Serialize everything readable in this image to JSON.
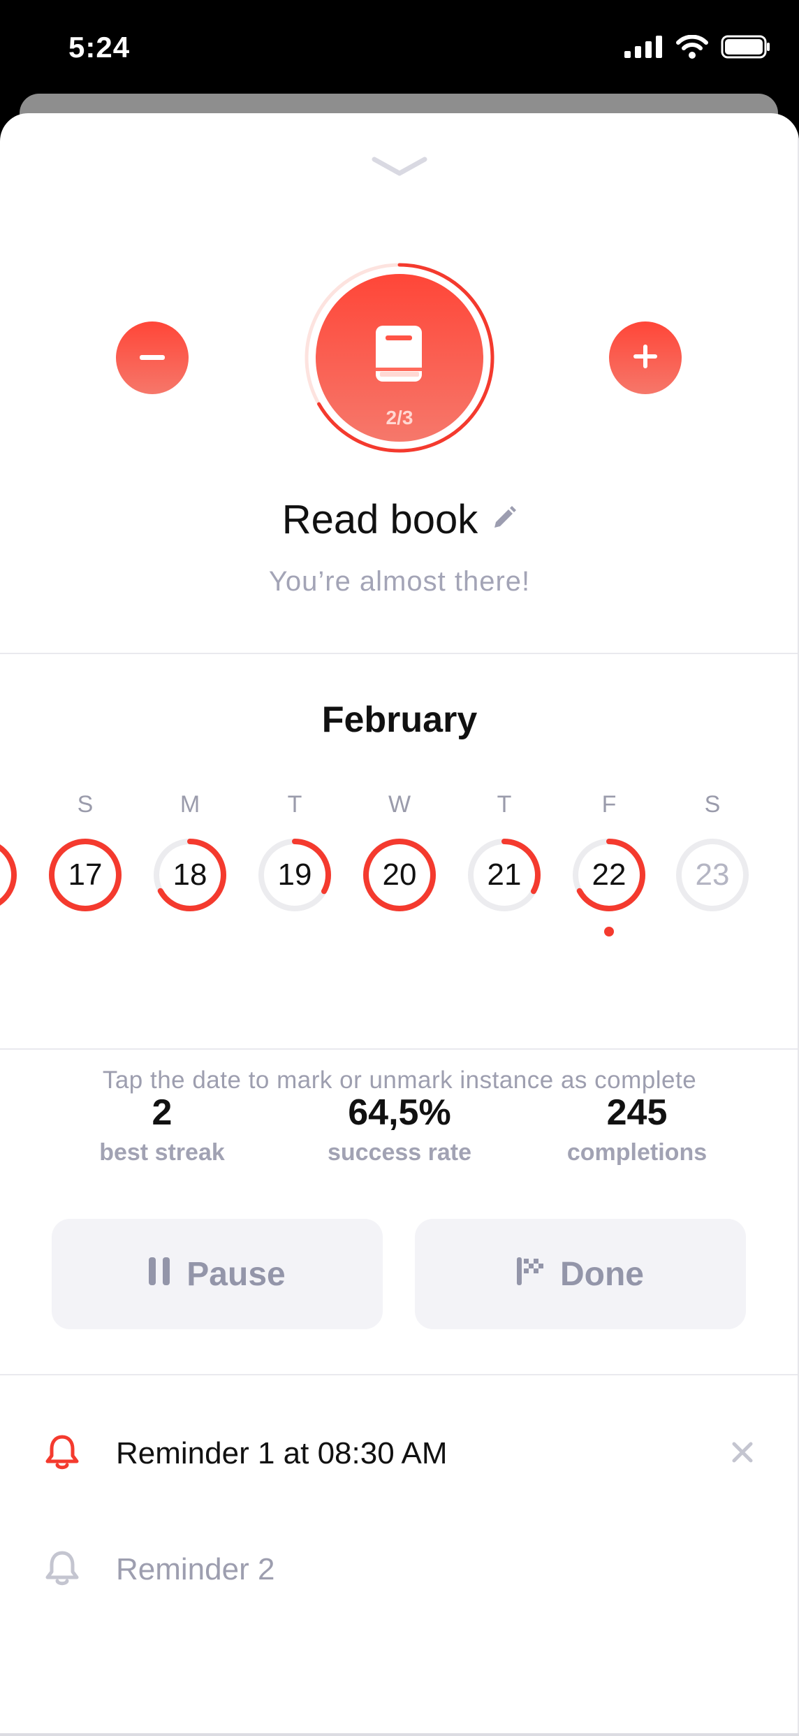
{
  "status_bar": {
    "time": "5:24",
    "icons": [
      "signal-icon",
      "wifi-icon",
      "battery-icon"
    ]
  },
  "habit": {
    "title": "Read book",
    "subtitle": "You’re almost there!",
    "progress_text": "2/3",
    "progress_fraction": 0.667,
    "icon": "book-icon",
    "accent_color": "#f43a2e"
  },
  "calendar": {
    "month": "February",
    "weekdays": [
      "S",
      "M",
      "T",
      "W",
      "T",
      "F",
      "S"
    ],
    "dates": [
      {
        "day": "17",
        "progress": 1.0,
        "muted": false
      },
      {
        "day": "18",
        "progress": 0.67,
        "muted": false
      },
      {
        "day": "19",
        "progress": 0.33,
        "muted": false
      },
      {
        "day": "20",
        "progress": 1.0,
        "muted": false
      },
      {
        "day": "21",
        "progress": 0.33,
        "muted": false
      },
      {
        "day": "22",
        "progress": 0.67,
        "muted": false,
        "today": true
      },
      {
        "day": "23",
        "progress": 0.0,
        "muted": true
      }
    ],
    "hint": "Tap the date to mark or unmark instance as complete"
  },
  "stats": [
    {
      "value": "2",
      "label": "best streak"
    },
    {
      "value": "64,5%",
      "label": "success rate"
    },
    {
      "value": "245",
      "label": "completions"
    }
  ],
  "actions": {
    "pause_label": "Pause",
    "done_label": "Done"
  },
  "reminders": [
    {
      "label": "Reminder 1 at 08:30 AM",
      "active": true
    },
    {
      "label": "Reminder 2",
      "active": false
    }
  ]
}
